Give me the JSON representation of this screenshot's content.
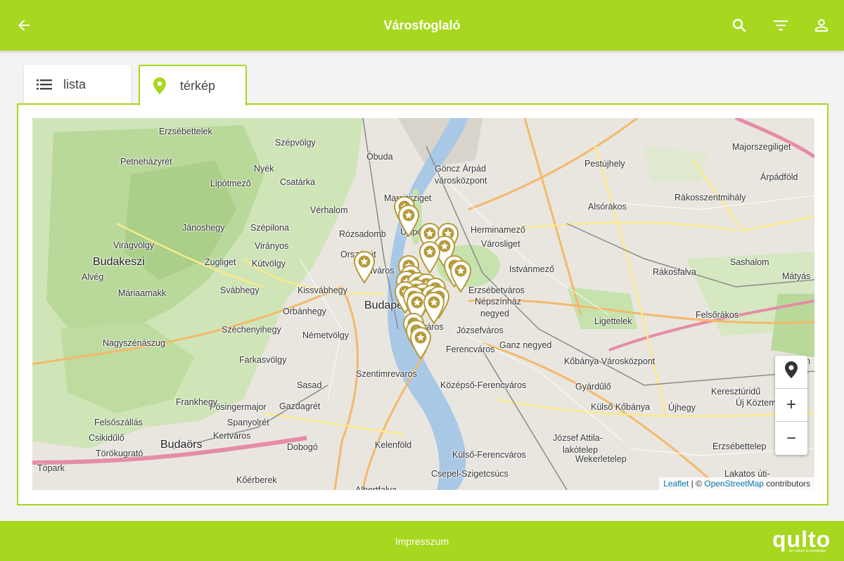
{
  "header": {
    "title": "Városfoglaló",
    "colors": {
      "accent": "#a7d71e"
    },
    "icons": {
      "back": "arrow-left-icon",
      "search": "search-icon",
      "filter": "filter-icon",
      "user": "user-icon"
    }
  },
  "tabs": [
    {
      "label": "lista",
      "icon": "list-icon",
      "active": false
    },
    {
      "label": "térkép",
      "icon": "map-pin-icon",
      "active": true
    }
  ],
  "map": {
    "labels": [
      "Erzsébettelek",
      "Szépvölgy",
      "Petneházyrét",
      "Nyék",
      "Óbuda",
      "Göncz Árpád",
      "városközpont",
      "Pestújhely",
      "Majorszegiliget",
      "Árpádföld",
      "Lipótmező",
      "Csatárka",
      "Margitsziget",
      "Vérhalom",
      "Alsórákos",
      "Rákosszentmihály",
      "Jánoshegy",
      "Szépilona",
      "Rózsadomb",
      "Újlipótváros",
      "Herminamező",
      "Virágvölgy",
      "Virányos",
      "Országút",
      "Városliget",
      "Budakeszi",
      "Zugliget",
      "Kútvölgy",
      "Víziváros",
      "Istvánmező",
      "Rákosfalva",
      "Sashalom",
      "Mátyás",
      "Alvég",
      "Máriaamakk",
      "Svábhegy",
      "Kissvábhegy",
      "Erzsébetváros",
      "Budapest",
      "Népszínház",
      "negyed",
      "Felsőrákos",
      "Orbánhegy",
      "Ligettelek",
      "Széchenyihegy",
      "Belváros",
      "Józsefváros",
      "Németvölgy",
      "Nagyszénászug",
      "Ferencváros",
      "Ganz negyed",
      "Farkasvölgy",
      "Kőbánya Városközpont",
      "Kőbán",
      "Szentimrevaros",
      "Középső-Ferencváros",
      "Gyárdűlő",
      "Pösingermajor",
      "Sasad",
      "Keresztúridű",
      "Új Köztem",
      "Frankhegy",
      "Gazdagrét",
      "Külső Kőbánya",
      "Újhegy",
      "Felsőszállás",
      "Spanyolrét",
      "József Attila-",
      "lakótelep",
      "Csikidűlő",
      "Kelenföld",
      "Törökugrató",
      "Budaörs",
      "Kertváros",
      "Dobogó",
      "Erzsébettelep",
      "Tópark",
      "Külső-Ferencváros",
      "Wekerletelep",
      "Kőérberek",
      "Csepel-Szigetcsúcs",
      "Albertfalva",
      "Lakatos úti-"
    ],
    "marker_count": 26,
    "marker_icon": "star-marker-icon",
    "controls": {
      "locate": "locate-icon",
      "zoom_in": "+",
      "zoom_out": "−"
    },
    "attribution": {
      "leaflet": "Leaflet",
      "sep": " | © ",
      "osm": "OpenStreetMap",
      "rest": " contributors"
    }
  },
  "footer": {
    "link": "Impresszum",
    "brand": "qulto",
    "tagline": "for culture & knowledge"
  }
}
